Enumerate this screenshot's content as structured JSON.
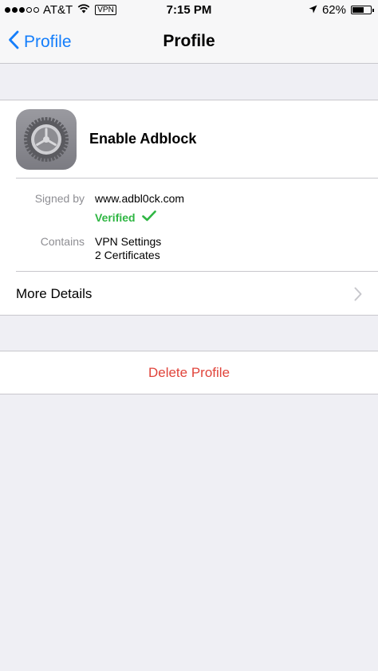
{
  "status_bar": {
    "carrier": "AT&T",
    "vpn": "VPN",
    "time": "7:15 PM",
    "battery": "62%",
    "battery_level": 0.62
  },
  "nav": {
    "back_label": "Profile",
    "title": "Profile"
  },
  "profile": {
    "name": "Enable Adblock",
    "icon": "settings-gear-icon",
    "signed_by_label": "Signed by",
    "signed_by_value": "www.adbl0ck.com",
    "verified_label": "Verified",
    "contains_label": "Contains",
    "contains_items": [
      "VPN Settings",
      "2 Certificates"
    ],
    "more_details_label": "More Details"
  },
  "actions": {
    "delete_label": "Delete Profile"
  },
  "colors": {
    "tint": "#147efb",
    "verified": "#2fb643",
    "destructive": "#e0443b",
    "background": "#efeff4"
  }
}
